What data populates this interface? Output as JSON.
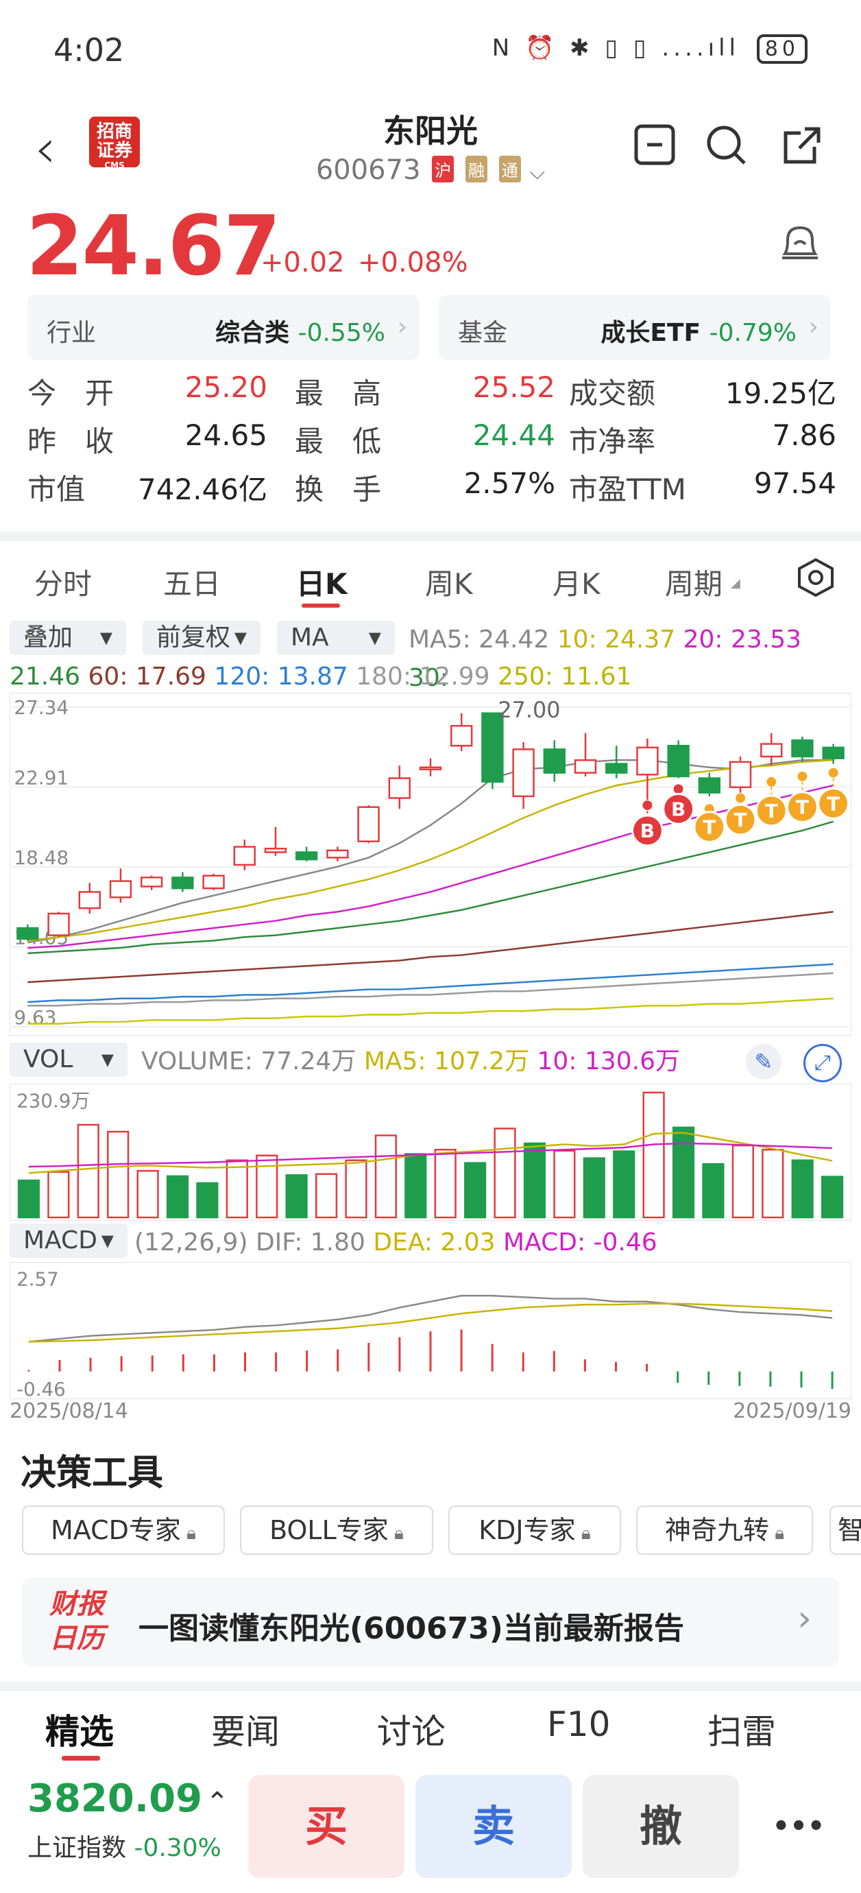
{
  "status_bar": {
    "time": "4:02",
    "icons": "N ⏰ ✱ ▯ ▯ ....ıll",
    "battery": "80"
  },
  "header": {
    "logo_text": "招商\n证券",
    "logo_sub": "CMS",
    "title": "东阳光",
    "code": "600673",
    "tags": [
      "沪",
      "融",
      "通"
    ]
  },
  "quote": {
    "price": "24.67",
    "change": "+0.02",
    "change_pct": "+0.08%",
    "industry_label": "行业",
    "industry_name": "综合类",
    "industry_pct": "-0.55%",
    "fund_label": "基金",
    "fund_name": "成长ETF",
    "fund_pct": "-0.79%",
    "rows": [
      [
        {
          "k": "今　开",
          "v": "25.20",
          "c": "red"
        },
        {
          "k": "最　高",
          "v": "25.52",
          "c": "red"
        },
        {
          "k": "成交额",
          "v": "19.25亿",
          "c": "dark"
        }
      ],
      [
        {
          "k": "昨　收",
          "v": "24.65",
          "c": "dark"
        },
        {
          "k": "最　低",
          "v": "24.44",
          "c": "green"
        },
        {
          "k": "市净率",
          "v": "7.86",
          "c": "dark"
        }
      ],
      [
        {
          "k": "市值",
          "v": "742.46亿",
          "c": "dark"
        },
        {
          "k": "换　手",
          "v": "2.57%",
          "c": "dark"
        },
        {
          "k": "市盈TTM",
          "v": "97.54",
          "c": "dark"
        }
      ]
    ]
  },
  "tabs": [
    "分时",
    "五日",
    "日K",
    "周K",
    "月K",
    "周期"
  ],
  "active_tab": "日K",
  "chart_controls": {
    "overlay": "叠加",
    "adjust": "前复权",
    "indicator": "MA"
  },
  "ma_legend": {
    "ma5": "MA5: 24.42",
    "ma10": "10: 24.37",
    "ma20": "20: 23.53",
    "ma30": "30:",
    "ma30v": "21.46",
    "ma60": "60: 17.69",
    "ma120": "120: 13.87",
    "ma180": "180: 12.99",
    "ma250": "250: 11.61"
  },
  "colors": {
    "up": "#e4393c",
    "down": "#1f9d4c",
    "ma5": "#888888",
    "ma10": "#c8b400",
    "ma20": "#d01fc8",
    "ma30": "#2e8b3a",
    "ma60": "#8b3a2e",
    "ma120": "#2b7fd0",
    "ma180": "#999999",
    "ma250": "#c8c800"
  },
  "chart_data": [
    {
      "type": "candlestick",
      "title": "日K",
      "y_ticks": [
        "27.34",
        "22.91",
        "18.48",
        "14.05",
        "9.63"
      ],
      "ylim": [
        9.63,
        27.34
      ],
      "high_label": "27.00",
      "candles": [
        {
          "o": 15.1,
          "c": 14.5,
          "h": 15.3,
          "l": 14.4
        },
        {
          "o": 14.7,
          "c": 15.9,
          "h": 16.0,
          "l": 14.6
        },
        {
          "o": 16.2,
          "c": 17.1,
          "h": 17.6,
          "l": 15.9
        },
        {
          "o": 16.8,
          "c": 17.7,
          "h": 18.4,
          "l": 16.5
        },
        {
          "o": 17.4,
          "c": 17.9,
          "h": 18.0,
          "l": 17.2
        },
        {
          "o": 17.9,
          "c": 17.3,
          "h": 18.2,
          "l": 17.1
        },
        {
          "o": 17.3,
          "c": 18.0,
          "h": 18.1,
          "l": 17.2
        },
        {
          "o": 18.6,
          "c": 19.6,
          "h": 20.0,
          "l": 18.3
        },
        {
          "o": 19.3,
          "c": 19.5,
          "h": 20.7,
          "l": 19.1
        },
        {
          "o": 19.3,
          "c": 18.9,
          "h": 19.6,
          "l": 18.8
        },
        {
          "o": 19.0,
          "c": 19.4,
          "h": 19.6,
          "l": 18.8
        },
        {
          "o": 19.9,
          "c": 21.8,
          "h": 21.9,
          "l": 19.8
        },
        {
          "o": 22.3,
          "c": 23.4,
          "h": 24.1,
          "l": 21.7
        },
        {
          "o": 24.0,
          "c": 24.0,
          "h": 24.5,
          "l": 23.5
        },
        {
          "o": 25.2,
          "c": 26.3,
          "h": 27.0,
          "l": 24.9
        },
        {
          "o": 27.0,
          "c": 23.2,
          "h": 27.0,
          "l": 22.8
        },
        {
          "o": 22.4,
          "c": 25.0,
          "h": 25.4,
          "l": 21.7
        },
        {
          "o": 25.0,
          "c": 23.7,
          "h": 25.5,
          "l": 23.2
        },
        {
          "o": 23.7,
          "c": 24.4,
          "h": 25.9,
          "l": 23.5
        },
        {
          "o": 24.2,
          "c": 23.7,
          "h": 25.2,
          "l": 23.4
        },
        {
          "o": 23.6,
          "c": 25.1,
          "h": 25.6,
          "l": 22.2
        },
        {
          "o": 25.2,
          "c": 23.5,
          "h": 25.5,
          "l": 23.4
        },
        {
          "o": 23.4,
          "c": 22.6,
          "h": 23.7,
          "l": 22.4
        },
        {
          "o": 22.9,
          "c": 24.3,
          "h": 24.6,
          "l": 22.6
        },
        {
          "o": 24.6,
          "c": 25.3,
          "h": 25.9,
          "l": 24.1
        },
        {
          "o": 25.5,
          "c": 24.6,
          "h": 25.7,
          "l": 24.3
        },
        {
          "o": 25.1,
          "c": 24.5,
          "h": 25.3,
          "l": 24.2
        }
      ],
      "ma_series": [
        {
          "key": "ma5",
          "values": [
            14.3,
            14.6,
            15.0,
            15.5,
            16.0,
            16.5,
            16.9,
            17.3,
            17.7,
            18.1,
            18.5,
            19.0,
            19.8,
            20.8,
            22.0,
            23.4,
            23.9,
            24.0,
            24.3,
            24.4,
            24.4,
            24.2,
            24.0,
            23.9,
            24.2,
            24.4,
            24.4
          ]
        },
        {
          "key": "ma10",
          "values": [
            14.4,
            14.6,
            14.8,
            15.1,
            15.4,
            15.7,
            16.0,
            16.3,
            16.7,
            17.0,
            17.4,
            17.8,
            18.3,
            18.9,
            19.6,
            20.4,
            21.2,
            21.9,
            22.5,
            23.0,
            23.3,
            23.6,
            23.8,
            24.0,
            24.1,
            24.3,
            24.4
          ]
        },
        {
          "key": "ma20",
          "values": [
            14.0,
            14.1,
            14.3,
            14.5,
            14.7,
            14.9,
            15.1,
            15.3,
            15.5,
            15.8,
            16.0,
            16.3,
            16.7,
            17.1,
            17.6,
            18.1,
            18.6,
            19.1,
            19.6,
            20.1,
            20.6,
            21.0,
            21.4,
            21.8,
            22.2,
            22.6,
            23.0
          ]
        },
        {
          "key": "ma30",
          "values": [
            13.7,
            13.8,
            13.9,
            14.0,
            14.2,
            14.3,
            14.4,
            14.6,
            14.7,
            14.9,
            15.1,
            15.3,
            15.5,
            15.8,
            16.1,
            16.5,
            16.9,
            17.3,
            17.7,
            18.1,
            18.5,
            18.9,
            19.3,
            19.7,
            20.1,
            20.5,
            21.0
          ]
        },
        {
          "key": "ma60",
          "values": [
            12.1,
            12.2,
            12.3,
            12.4,
            12.5,
            12.6,
            12.7,
            12.8,
            12.9,
            13.0,
            13.1,
            13.2,
            13.3,
            13.5,
            13.6,
            13.8,
            14.0,
            14.2,
            14.4,
            14.6,
            14.8,
            15.0,
            15.2,
            15.4,
            15.6,
            15.8,
            16.0
          ]
        },
        {
          "key": "ma120",
          "values": [
            11.0,
            11.1,
            11.1,
            11.2,
            11.2,
            11.3,
            11.3,
            11.4,
            11.4,
            11.5,
            11.6,
            11.7,
            11.7,
            11.8,
            11.9,
            12.0,
            12.1,
            12.2,
            12.3,
            12.4,
            12.5,
            12.6,
            12.7,
            12.8,
            12.9,
            13.0,
            13.1
          ]
        },
        {
          "key": "ma180",
          "values": [
            10.8,
            10.8,
            10.9,
            10.9,
            11.0,
            11.0,
            11.1,
            11.1,
            11.2,
            11.2,
            11.3,
            11.3,
            11.4,
            11.4,
            11.5,
            11.6,
            11.6,
            11.7,
            11.8,
            11.9,
            12.0,
            12.1,
            12.2,
            12.3,
            12.4,
            12.5,
            12.6
          ]
        },
        {
          "key": "ma250",
          "values": [
            9.8,
            9.8,
            9.9,
            9.9,
            10.0,
            10.0,
            10.0,
            10.1,
            10.1,
            10.2,
            10.2,
            10.3,
            10.3,
            10.4,
            10.4,
            10.5,
            10.5,
            10.6,
            10.6,
            10.7,
            10.8,
            10.8,
            10.9,
            10.9,
            11.0,
            11.1,
            11.2
          ]
        }
      ],
      "markers": [
        {
          "i": 20,
          "label": "B",
          "value": 20.5,
          "y": 21.9
        },
        {
          "i": 21,
          "label": "B",
          "value": 21.7,
          "y": 22.8
        },
        {
          "i": 22,
          "label": "T",
          "value": 20.7,
          "y": 21.7
        },
        {
          "i": 23,
          "label": "T",
          "value": 21.1,
          "y": 22.3
        },
        {
          "i": 24,
          "label": "T",
          "value": 21.6,
          "y": 23.2
        },
        {
          "i": 25,
          "label": "T",
          "value": 21.8,
          "y": 23.5
        },
        {
          "i": 26,
          "label": "T",
          "value": 22.0,
          "y": 23.7
        }
      ]
    },
    {
      "type": "bar",
      "title": "VOL",
      "legend": {
        "volume": "VOLUME: 77.24万",
        "ma5": "MA5: 107.2万",
        "ma10": "10: 130.6万"
      },
      "y_tick": "230.9万",
      "ylim": [
        0,
        230.9
      ],
      "values": [
        70,
        86,
        175,
        162,
        88,
        78,
        65,
        108,
        117,
        80,
        82,
        108,
        155,
        120,
        128,
        103,
        168,
        140,
        126,
        112,
        125,
        236,
        170,
        101,
        136,
        128,
        108,
        77
      ],
      "up": [
        false,
        true,
        true,
        true,
        true,
        false,
        false,
        true,
        true,
        false,
        true,
        true,
        true,
        false,
        true,
        false,
        true,
        false,
        true,
        false,
        false,
        true,
        false,
        false,
        true,
        true,
        false,
        false
      ],
      "ma5": [
        84,
        88,
        92,
        96,
        98,
        96,
        94,
        95,
        97,
        99,
        101,
        103,
        110,
        118,
        122,
        125,
        130,
        134,
        138,
        135,
        138,
        158,
        160,
        150,
        140,
        130,
        118,
        107
      ],
      "ma10": [
        96,
        97,
        99,
        101,
        102,
        103,
        104,
        106,
        108,
        110,
        112,
        114,
        116,
        118,
        120,
        122,
        124,
        126,
        128,
        130,
        132,
        138,
        140,
        139,
        137,
        135,
        133,
        131
      ]
    },
    {
      "type": "bar",
      "title": "MACD",
      "legend": {
        "name": "MACD",
        "params": "(12,26,9)",
        "dif": "DIF: 1.80",
        "dea": "DEA: 2.03",
        "macd": "MACD: -0.46"
      },
      "y_ticks": [
        "2.57",
        "-0.46"
      ],
      "ylim": [
        -0.46,
        2.57
      ],
      "x_ticks": [
        "2025/08/14",
        "2025/09/19"
      ],
      "hist": [
        0.04,
        0.3,
        0.36,
        0.4,
        0.42,
        0.45,
        0.45,
        0.5,
        0.5,
        0.55,
        0.58,
        0.75,
        0.9,
        1.05,
        1.1,
        0.72,
        0.5,
        0.54,
        0.32,
        0.25,
        0.2,
        -0.3,
        -0.35,
        -0.38,
        -0.4,
        -0.42,
        -0.46
      ],
      "dif": [
        1.0,
        1.1,
        1.2,
        1.25,
        1.3,
        1.35,
        1.4,
        1.5,
        1.55,
        1.65,
        1.75,
        1.9,
        2.15,
        2.35,
        2.55,
        2.55,
        2.5,
        2.45,
        2.45,
        2.35,
        2.35,
        2.25,
        2.1,
        2.0,
        1.95,
        1.9,
        1.8
      ],
      "dea": [
        1.0,
        1.02,
        1.05,
        1.1,
        1.15,
        1.2,
        1.25,
        1.3,
        1.35,
        1.4,
        1.45,
        1.55,
        1.65,
        1.8,
        1.95,
        2.05,
        2.15,
        2.2,
        2.25,
        2.25,
        2.28,
        2.28,
        2.25,
        2.2,
        2.15,
        2.1,
        2.03
      ]
    }
  ],
  "tools_title": "决策工具",
  "tools": [
    "MACD专家",
    "BOLL专家",
    "KDJ专家",
    "神奇九转",
    "智"
  ],
  "banner": {
    "logo": "财报\n日历",
    "text": "一图读懂东阳光(600673)当前最新报告"
  },
  "bottom_tabs": [
    "精选",
    "要闻",
    "讨论",
    "F10",
    "扫雷"
  ],
  "index": {
    "value": "3820.09",
    "name": "上证指数",
    "pct": "-0.30%"
  },
  "actions": {
    "buy": "买",
    "sell": "卖",
    "cancel": "撤",
    "more": "•••"
  }
}
